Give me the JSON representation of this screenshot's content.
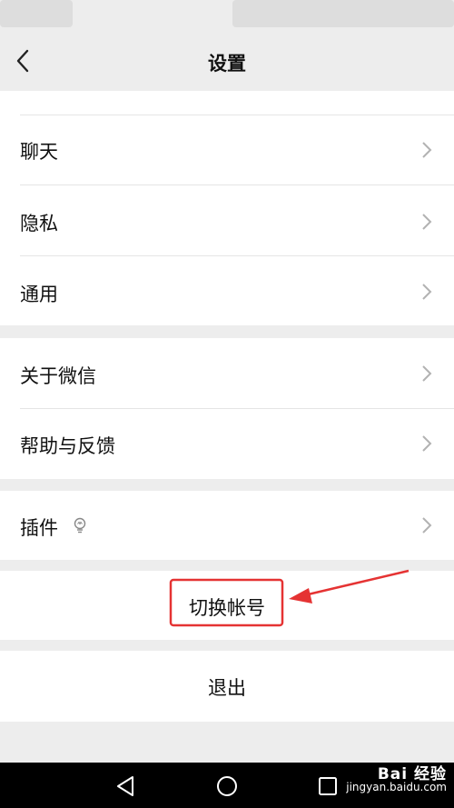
{
  "header": {
    "title": "设置"
  },
  "group1": {
    "items": [
      {
        "label": "聊天"
      },
      {
        "label": "隐私"
      },
      {
        "label": "通用"
      }
    ]
  },
  "group2": {
    "items": [
      {
        "label": "关于微信"
      },
      {
        "label": "帮助与反馈"
      }
    ]
  },
  "group3": {
    "items": [
      {
        "label": "插件"
      }
    ]
  },
  "switch_account": {
    "label": "切换帐号"
  },
  "logout": {
    "label": "退出"
  },
  "annotation_color": "#e53333",
  "watermark": {
    "brand": "Bai 经验",
    "url": "jingyan.baidu.com"
  }
}
